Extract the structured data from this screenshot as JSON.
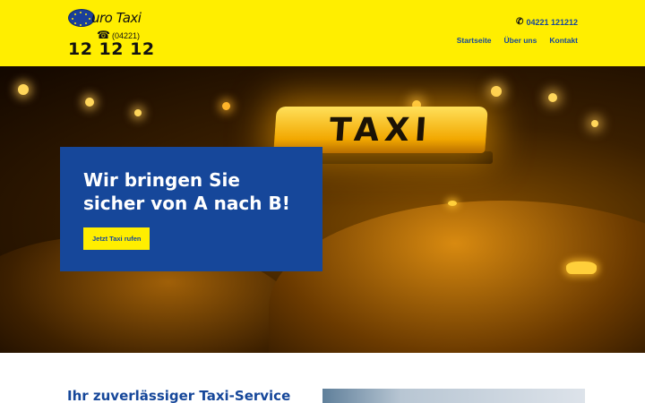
{
  "brand": {
    "logo_text": "uro Taxi",
    "logo_prefix": "(04221)",
    "logo_number": "12 12 12"
  },
  "header": {
    "phone": "04221 121212",
    "nav": [
      {
        "label": "Startseite"
      },
      {
        "label": "Über uns"
      },
      {
        "label": "Kontakt"
      }
    ]
  },
  "hero": {
    "sign_text": "TAXI",
    "title": "Wir bringen Sie sicher von A nach B!",
    "cta_label": "Jetzt Taxi rufen"
  },
  "section": {
    "title": "Ihr zuverlässiger Taxi-Service"
  },
  "colors": {
    "header_bg": "#ffee00",
    "brand_blue": "#16479a",
    "cta_bg": "#ffee00"
  },
  "icons": [
    "euro-stars-logo-icon",
    "telephone-icon",
    "phone-icon"
  ]
}
